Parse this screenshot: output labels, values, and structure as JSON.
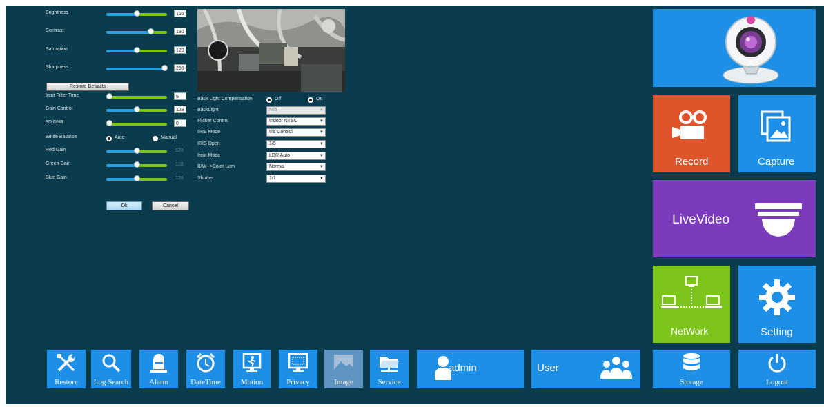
{
  "image_settings": {
    "brightness": {
      "label": "Brightness",
      "value": "126",
      "level": 0.5
    },
    "contrast": {
      "label": "Contrast",
      "value": "190",
      "level": 0.75
    },
    "saturation": {
      "label": "Saturation",
      "value": "128",
      "level": 0.5
    },
    "sharpness": {
      "label": "Sharpness",
      "value": "255",
      "level": 1.0
    },
    "restore_defaults_label": "Restore Defaults",
    "ircut_filter_time": {
      "label": "Ircut Filter Time",
      "value": "5",
      "level": 0.0
    },
    "gain_control": {
      "label": "Gain Control",
      "value": "128",
      "level": 0.5
    },
    "dnr_3d": {
      "label": "3D DNR",
      "value": "0",
      "level": 0.0
    },
    "white_balance": {
      "label": "White Balance",
      "options": [
        "Auto",
        "Manual"
      ],
      "selected": "Auto"
    },
    "red_gain": {
      "label": "Red Gain",
      "value": "128",
      "level": 0.5
    },
    "green_gain": {
      "label": "Green Gain",
      "value": "128",
      "level": 0.5
    },
    "blue_gain": {
      "label": "Blue Gain",
      "value": "128",
      "level": 0.5
    },
    "ok_label": "Ok",
    "cancel_label": "Cancel"
  },
  "camera_settings": {
    "back_light_compensation": {
      "label": "Back Light Compensation",
      "options": [
        "Off",
        "On"
      ],
      "selected": "On"
    },
    "backlight": {
      "label": "BackLight",
      "value": "Mid",
      "disabled": true
    },
    "flicker_control": {
      "label": "Flicker Control",
      "value": "Indoor NTSC"
    },
    "iris_mode": {
      "label": "IRIS Mode",
      "value": "Iris Control"
    },
    "iris_open": {
      "label": "IRIS Open",
      "value": "1/5"
    },
    "ircut_mode": {
      "label": "Ircut Mode",
      "value": "LDR Auto"
    },
    "bw_color_lum": {
      "label": "B/W-->Color Lum",
      "value": "Normal"
    },
    "shutter": {
      "label": "Shutter",
      "value": "1/1"
    }
  },
  "tiles": {
    "webcam": {
      "label": "",
      "color": "#1e8fe6",
      "icon": "webcam-icon"
    },
    "record": {
      "label": "Record",
      "color": "#e0542c",
      "icon": "video-camera-icon"
    },
    "capture": {
      "label": "Capture",
      "color": "#1e8fe6",
      "icon": "photos-icon"
    },
    "livevideo": {
      "label": "LiveVideo",
      "color": "#7c3bbd",
      "icon": "dome-camera-icon"
    },
    "network": {
      "label": "NetWork",
      "color": "#7ec51b",
      "icon": "network-icon"
    },
    "setting": {
      "label": "Setting",
      "color": "#1e8fe6",
      "icon": "gear-icon"
    }
  },
  "bottom_bar": {
    "restore": "Restore",
    "log_search": "Log Search",
    "alarm": "Alarm",
    "datetime": "DateTime",
    "motion": "Motion",
    "privacy": "Privacy",
    "image": "Image",
    "service": "Service",
    "admin": "admin",
    "user": "User",
    "storage": "Storage",
    "logout": "Logout"
  }
}
